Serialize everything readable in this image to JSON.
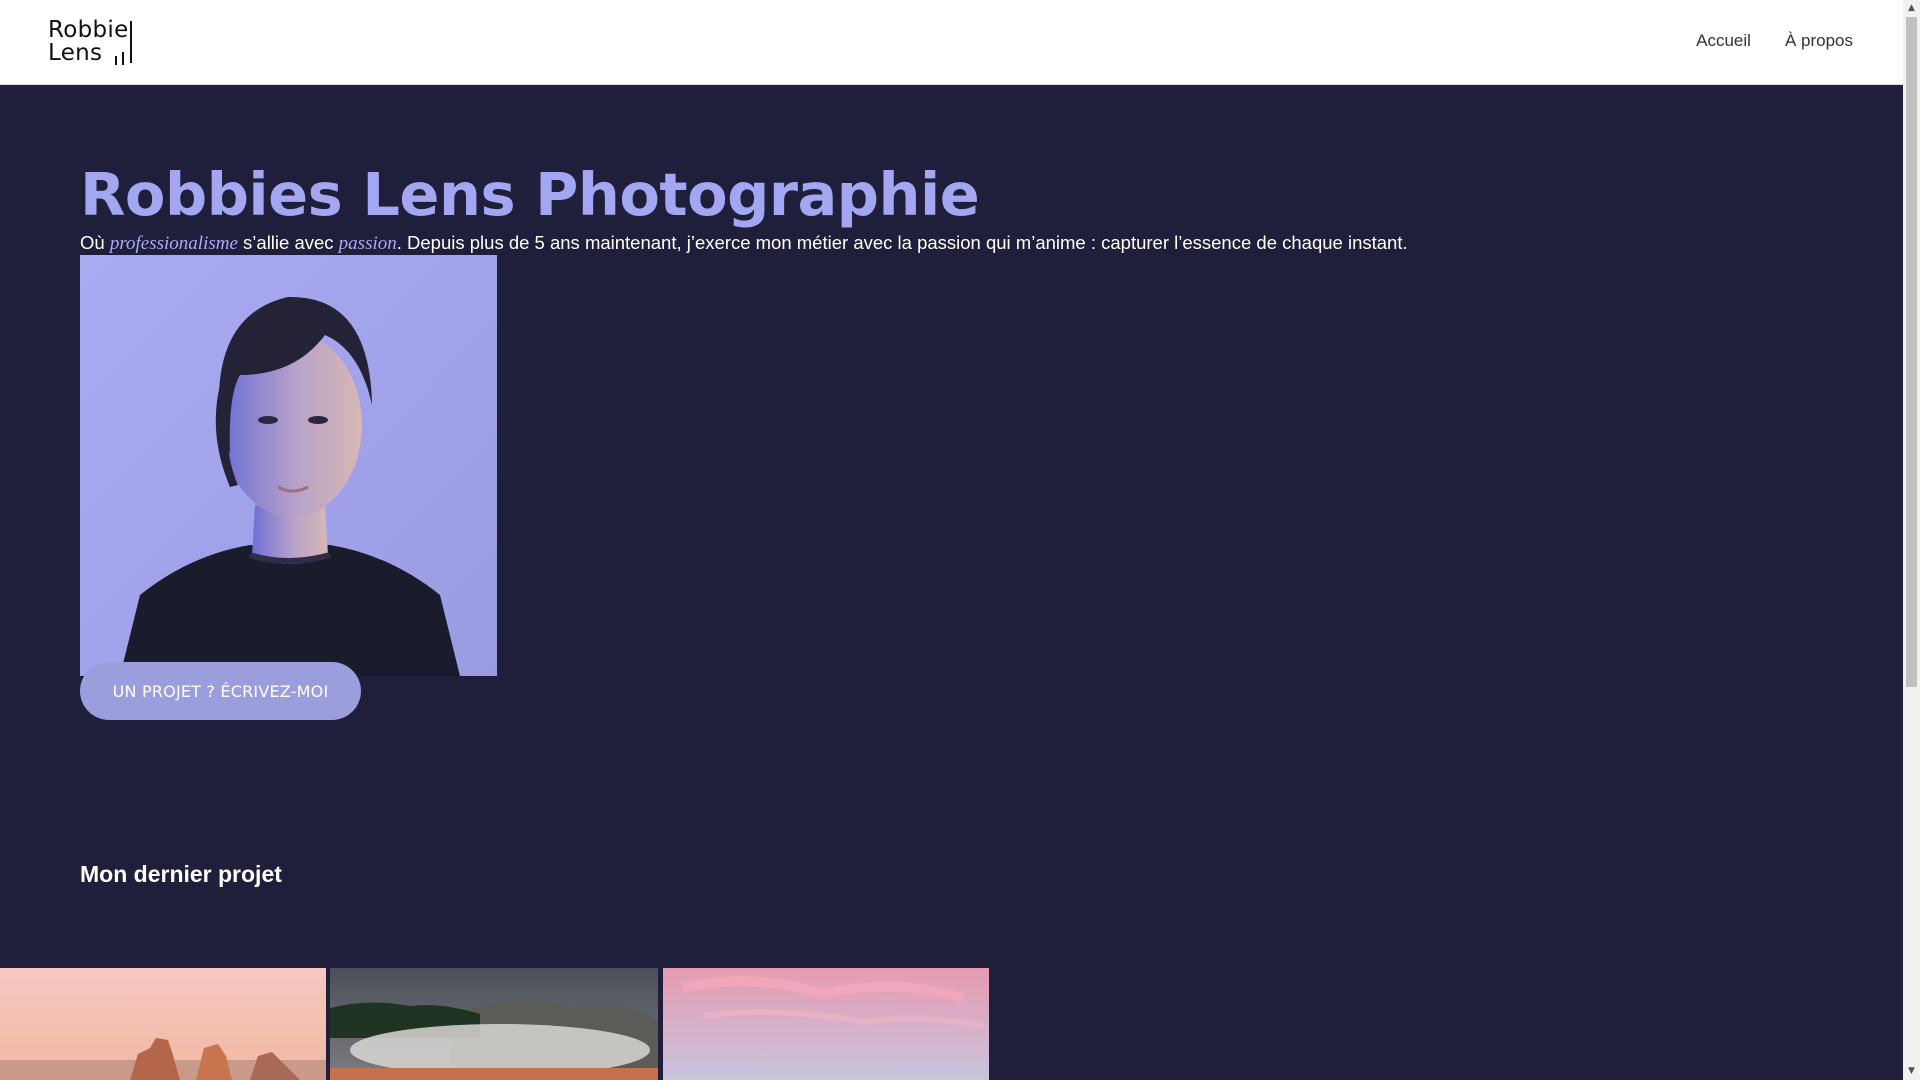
{
  "header": {
    "logo": {
      "line1": "Robbie",
      "line2": "Lens"
    },
    "nav": [
      {
        "label": "Accueil"
      },
      {
        "label": "À propos"
      }
    ]
  },
  "hero": {
    "title": "Robbies Lens Photographie",
    "intro": {
      "prefix": "Où ",
      "emphasis1": "professionalisme",
      "middle": " s’allie avec ",
      "emphasis2": "passion",
      "suffix": ". Depuis plus de 5 ans maintenant, j’exerce mon métier avec la passion qui m’anime : capturer l’essence de chaque instant."
    },
    "portrait_description": "Portrait d'une femme sur fond lavande",
    "cta_label": "UN PROJET ? ÉCRIVEZ-MOI"
  },
  "latest_project": {
    "title": "Mon dernier projet",
    "gallery": [
      {
        "icon": "coastal-sunset-photo"
      },
      {
        "icon": "misty-lake-photo"
      },
      {
        "icon": "pink-sky-photo"
      }
    ]
  },
  "colors": {
    "background": "#1f1f3b",
    "accent": "#a3a6f0",
    "button": "#9b9ddc",
    "header": "#ffffff"
  }
}
